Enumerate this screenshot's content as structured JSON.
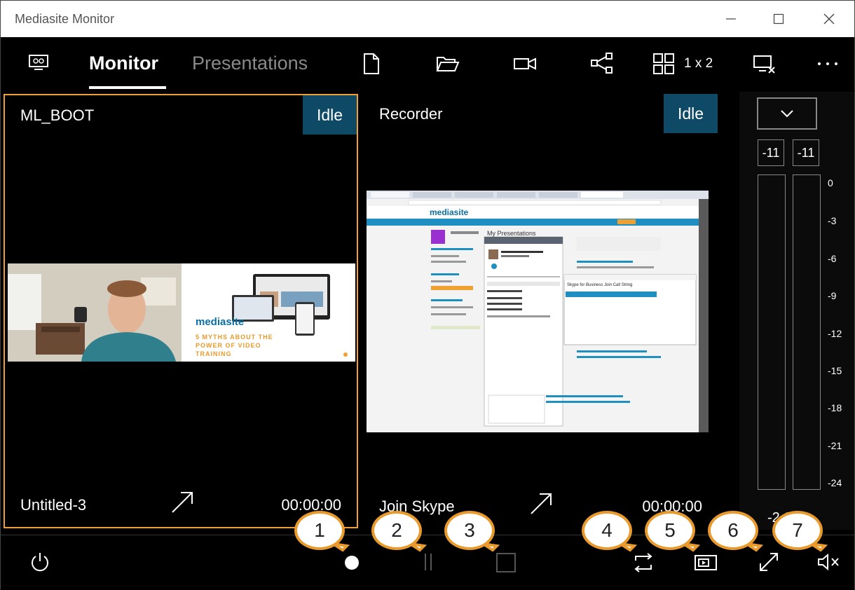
{
  "window": {
    "title": "Mediasite Monitor"
  },
  "toolbar": {
    "tabs": [
      {
        "label": "Monitor",
        "active": true
      },
      {
        "label": "Presentations",
        "active": false
      }
    ],
    "layout_label": "1 x 2"
  },
  "tiles": [
    {
      "name": "ML_BOOT",
      "status": "Idle",
      "presentation": "Untitled-3",
      "time": "00:00:00",
      "selected": true
    },
    {
      "name": "Recorder",
      "status": "Idle",
      "presentation": "Join Skype",
      "time": "00:00:00",
      "selected": false
    }
  ],
  "audio": {
    "levels": [
      "-11",
      "-11"
    ],
    "ticks": [
      "0",
      "-3",
      "-6",
      "-9",
      "-12",
      "-15",
      "-18",
      "-21",
      "-24"
    ],
    "status_text": "-2 S"
  },
  "preview": {
    "brand": "mediasite",
    "slide_text": [
      "5 MYTHS ABOUT THE",
      "POWER OF VIDEO",
      "TRAINING"
    ],
    "page_heading": "My Presentations",
    "dialog_title": "Skype for Business Join Call String"
  },
  "callouts": [
    "1",
    "2",
    "3",
    "4",
    "5",
    "6",
    "7"
  ],
  "colors": {
    "accent": "#f0a030",
    "idle": "#0e4a66",
    "callout_border": "#e99a2c"
  }
}
